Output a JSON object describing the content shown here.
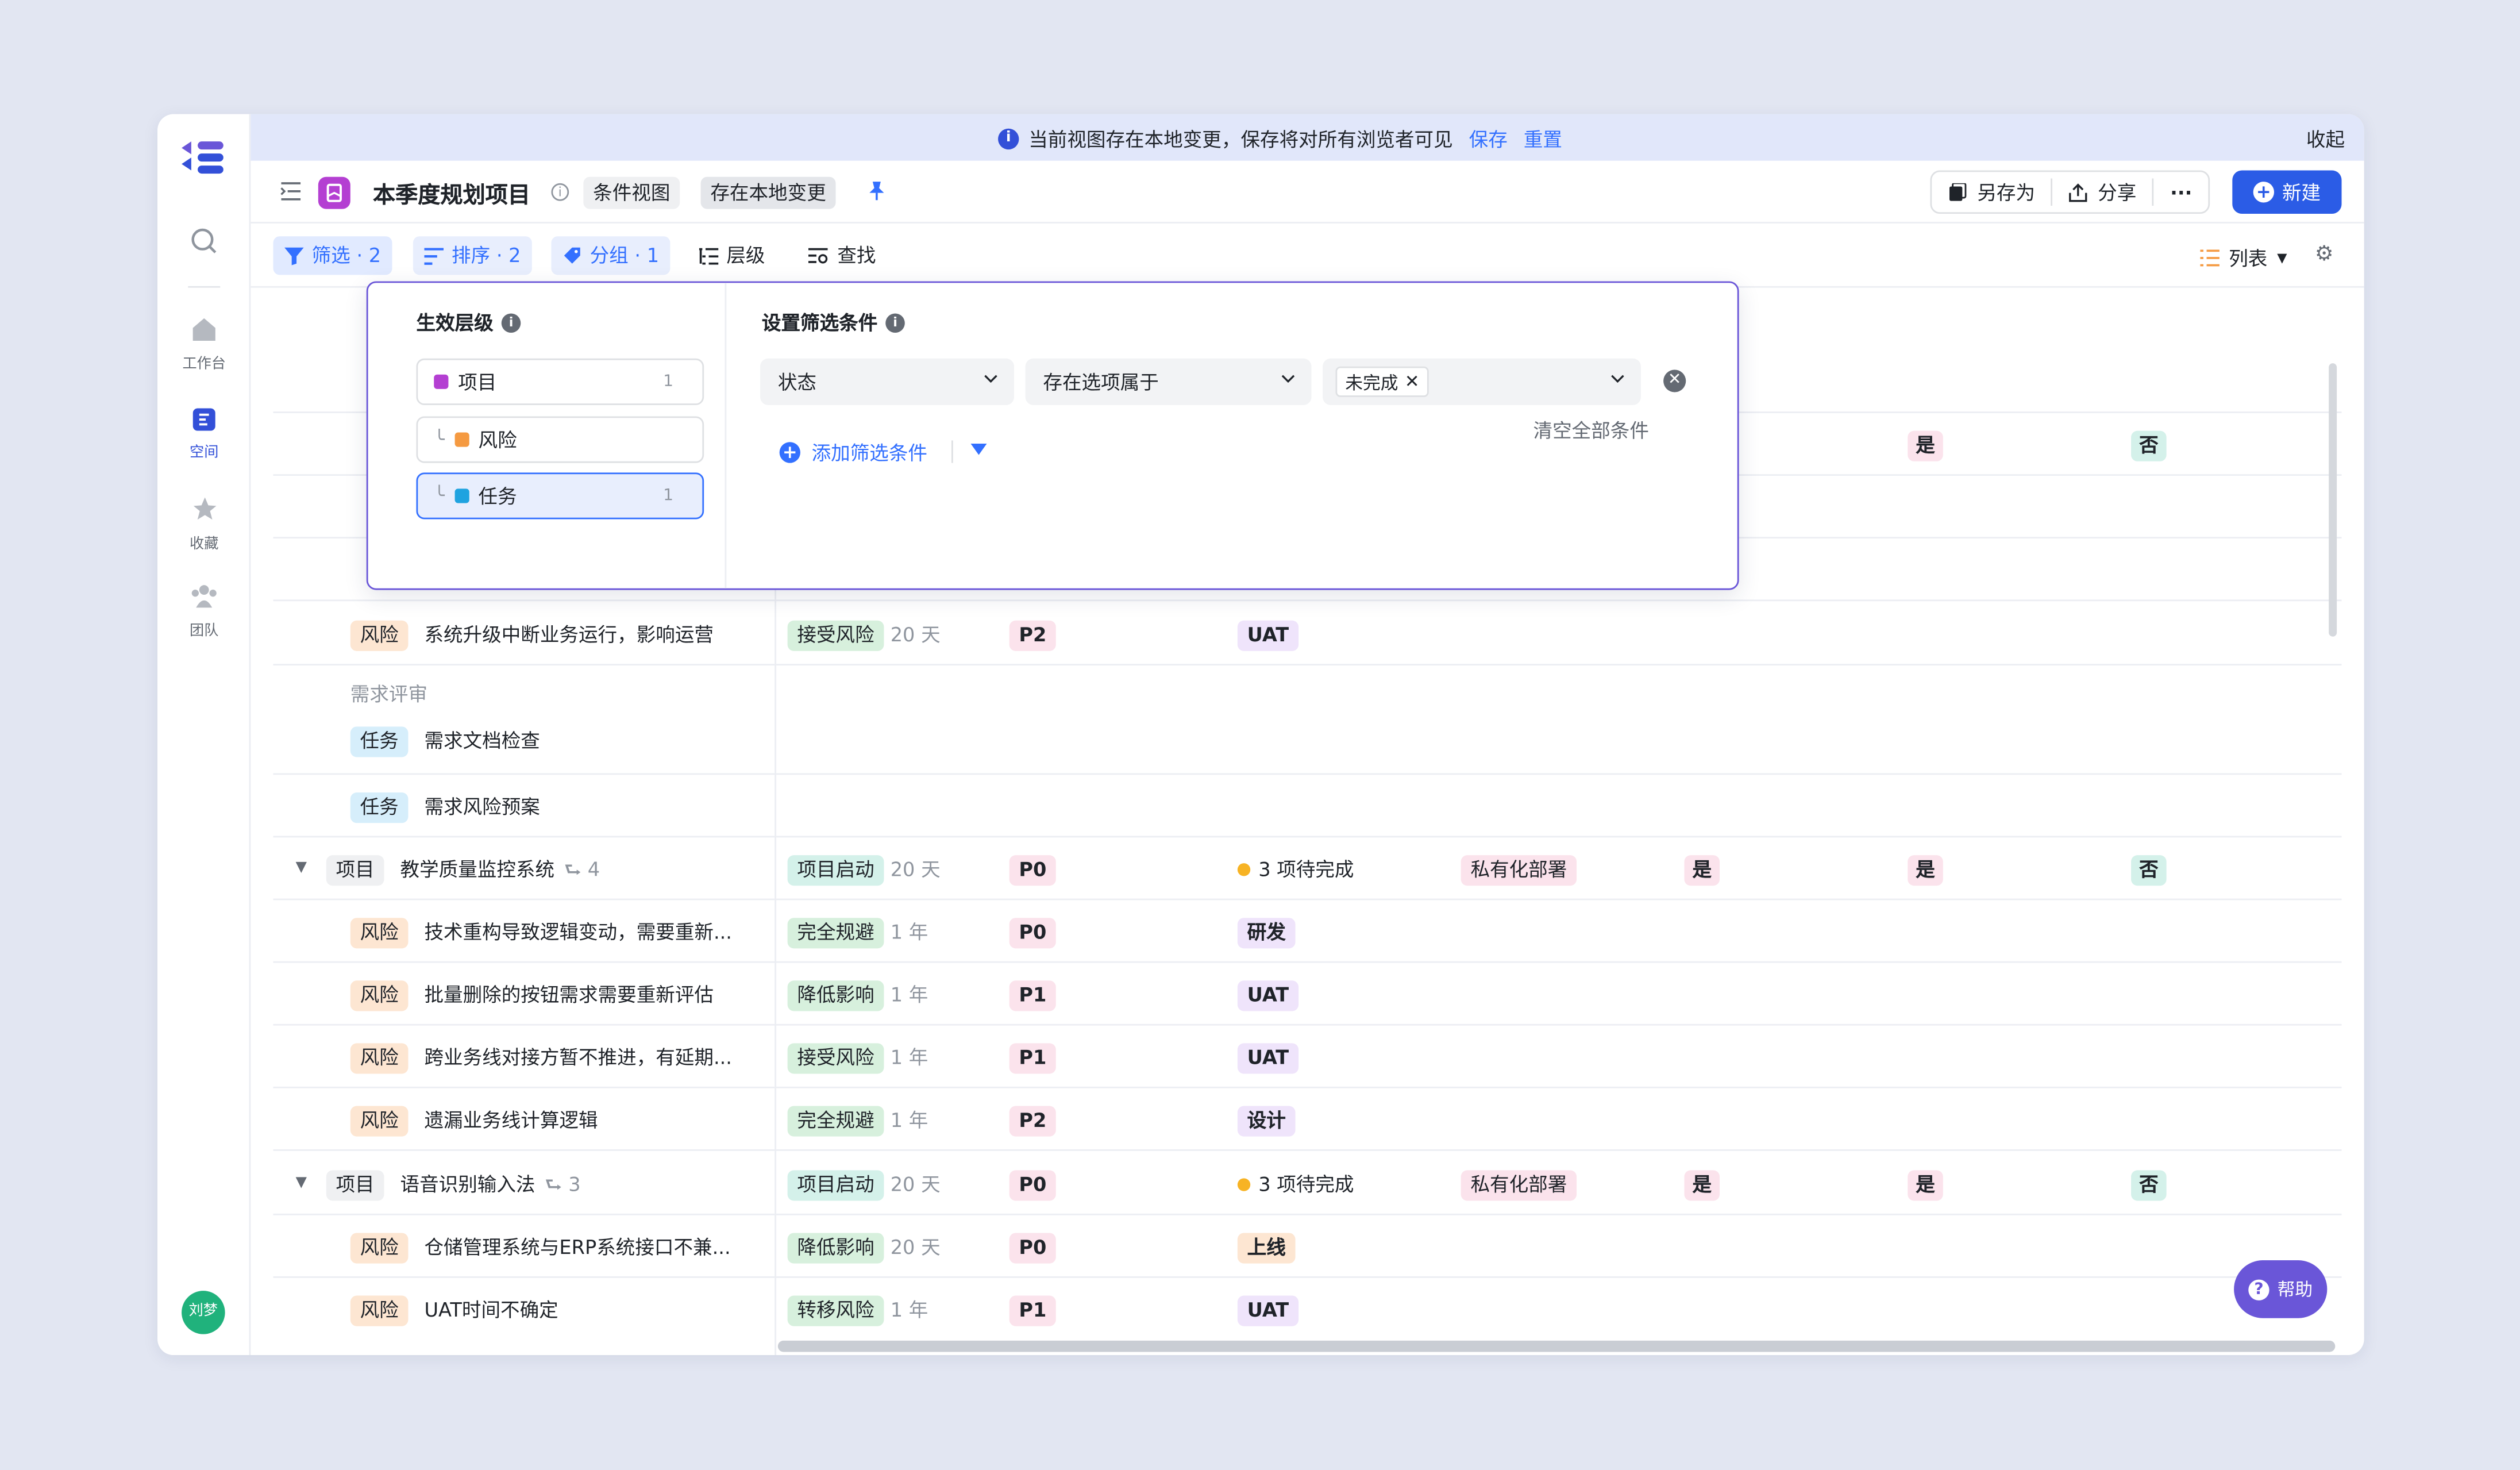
{
  "colors": {
    "accent": "#3370ff",
    "primary_button": "#2b5ce6",
    "popup_border": "#6a56d8",
    "project_icon": "#b43fd2"
  },
  "sidebar": {
    "items": [
      {
        "icon": "search-icon",
        "label": ""
      },
      {
        "icon": "home-icon",
        "label": "工作台"
      },
      {
        "icon": "space-icon",
        "label": "空间"
      },
      {
        "icon": "star-icon",
        "label": "收藏"
      },
      {
        "icon": "team-icon",
        "label": "团队"
      }
    ],
    "avatar": "刘梦"
  },
  "banner": {
    "message": "当前视图存在本地变更，保存将对所有浏览者可见",
    "save": "保存",
    "reset": "重置",
    "collapse": "收起"
  },
  "titlebar": {
    "title": "本季度规划项目",
    "tag_view": "条件视图",
    "tag_local": "存在本地变更",
    "save_as": "另存为",
    "share": "分享",
    "more": "···",
    "new": "新建"
  },
  "toolbar": {
    "filter": "筛选 · 2",
    "sort": "排序 · 2",
    "group": "分组 · 1",
    "level": "层级",
    "find": "查找",
    "view": "列表"
  },
  "filter_popup": {
    "left_title": "生效层级",
    "levels": [
      {
        "label": "项目",
        "count": "1",
        "color": "#b43fd2"
      },
      {
        "label": "风险",
        "count": "",
        "color": "#f59a41"
      },
      {
        "label": "任务",
        "count": "1",
        "color": "#1fa3e0"
      }
    ],
    "right_title": "设置筛选条件",
    "field": "状态",
    "operator": "存在选项属于",
    "value_chip": "未完成",
    "clear_all": "清空全部条件",
    "add_condition": "添加筛选条件"
  },
  "rows": [
    {
      "type": "yesno",
      "yes1": "是",
      "yes2": "是",
      "no": "否"
    },
    {
      "type": "item",
      "kind": "风险",
      "title": "系统升级中断业务运行，影响运营",
      "stage": "接受风险",
      "dur": "20 天",
      "pri": "P2",
      "phase": "UAT"
    },
    {
      "type": "group",
      "kind": "任务",
      "group": "需求评审",
      "title": "需求文档检查"
    },
    {
      "type": "task",
      "kind": "任务",
      "title": "需求风险预案"
    },
    {
      "type": "project",
      "kind": "项目",
      "title": "教学质量监控系统",
      "sub": "4",
      "stage": "项目启动",
      "dur": "20 天",
      "pri": "P0",
      "status": "3 项待完成",
      "deploy": "私有化部署",
      "yes1": "是",
      "yes2": "是",
      "no": "否"
    },
    {
      "type": "item",
      "kind": "风险",
      "title": "技术重构导致逻辑变动，需要重新...",
      "stage": "完全规避",
      "dur": "1 年",
      "pri": "P0",
      "phase": "研发"
    },
    {
      "type": "item",
      "kind": "风险",
      "title": "批量删除的按钮需求需要重新评估",
      "stage": "降低影响",
      "dur": "1 年",
      "pri": "P1",
      "phase": "UAT"
    },
    {
      "type": "item",
      "kind": "风险",
      "title": "跨业务线对接方暂不推进，有延期...",
      "stage": "接受风险",
      "dur": "1 年",
      "pri": "P1",
      "phase": "UAT"
    },
    {
      "type": "item",
      "kind": "风险",
      "title": "遗漏业务线计算逻辑",
      "stage": "完全规避",
      "dur": "1 年",
      "pri": "P2",
      "phase": "设计"
    },
    {
      "type": "project",
      "kind": "项目",
      "title": "语音识别输入法",
      "sub": "3",
      "stage": "项目启动",
      "dur": "20 天",
      "pri": "P0",
      "status": "3 项待完成",
      "deploy": "私有化部署",
      "yes1": "是",
      "yes2": "是",
      "no": "否"
    },
    {
      "type": "item",
      "kind": "风险",
      "title": "仓储管理系统与ERP系统接口不兼...",
      "stage": "降低影响",
      "dur": "20 天",
      "pri": "P0",
      "phase": "上线"
    },
    {
      "type": "item",
      "kind": "风险",
      "title": "UAT时间不确定",
      "stage": "转移风险",
      "dur": "1 年",
      "pri": "P1",
      "phase": "UAT"
    }
  ],
  "help": "帮助"
}
